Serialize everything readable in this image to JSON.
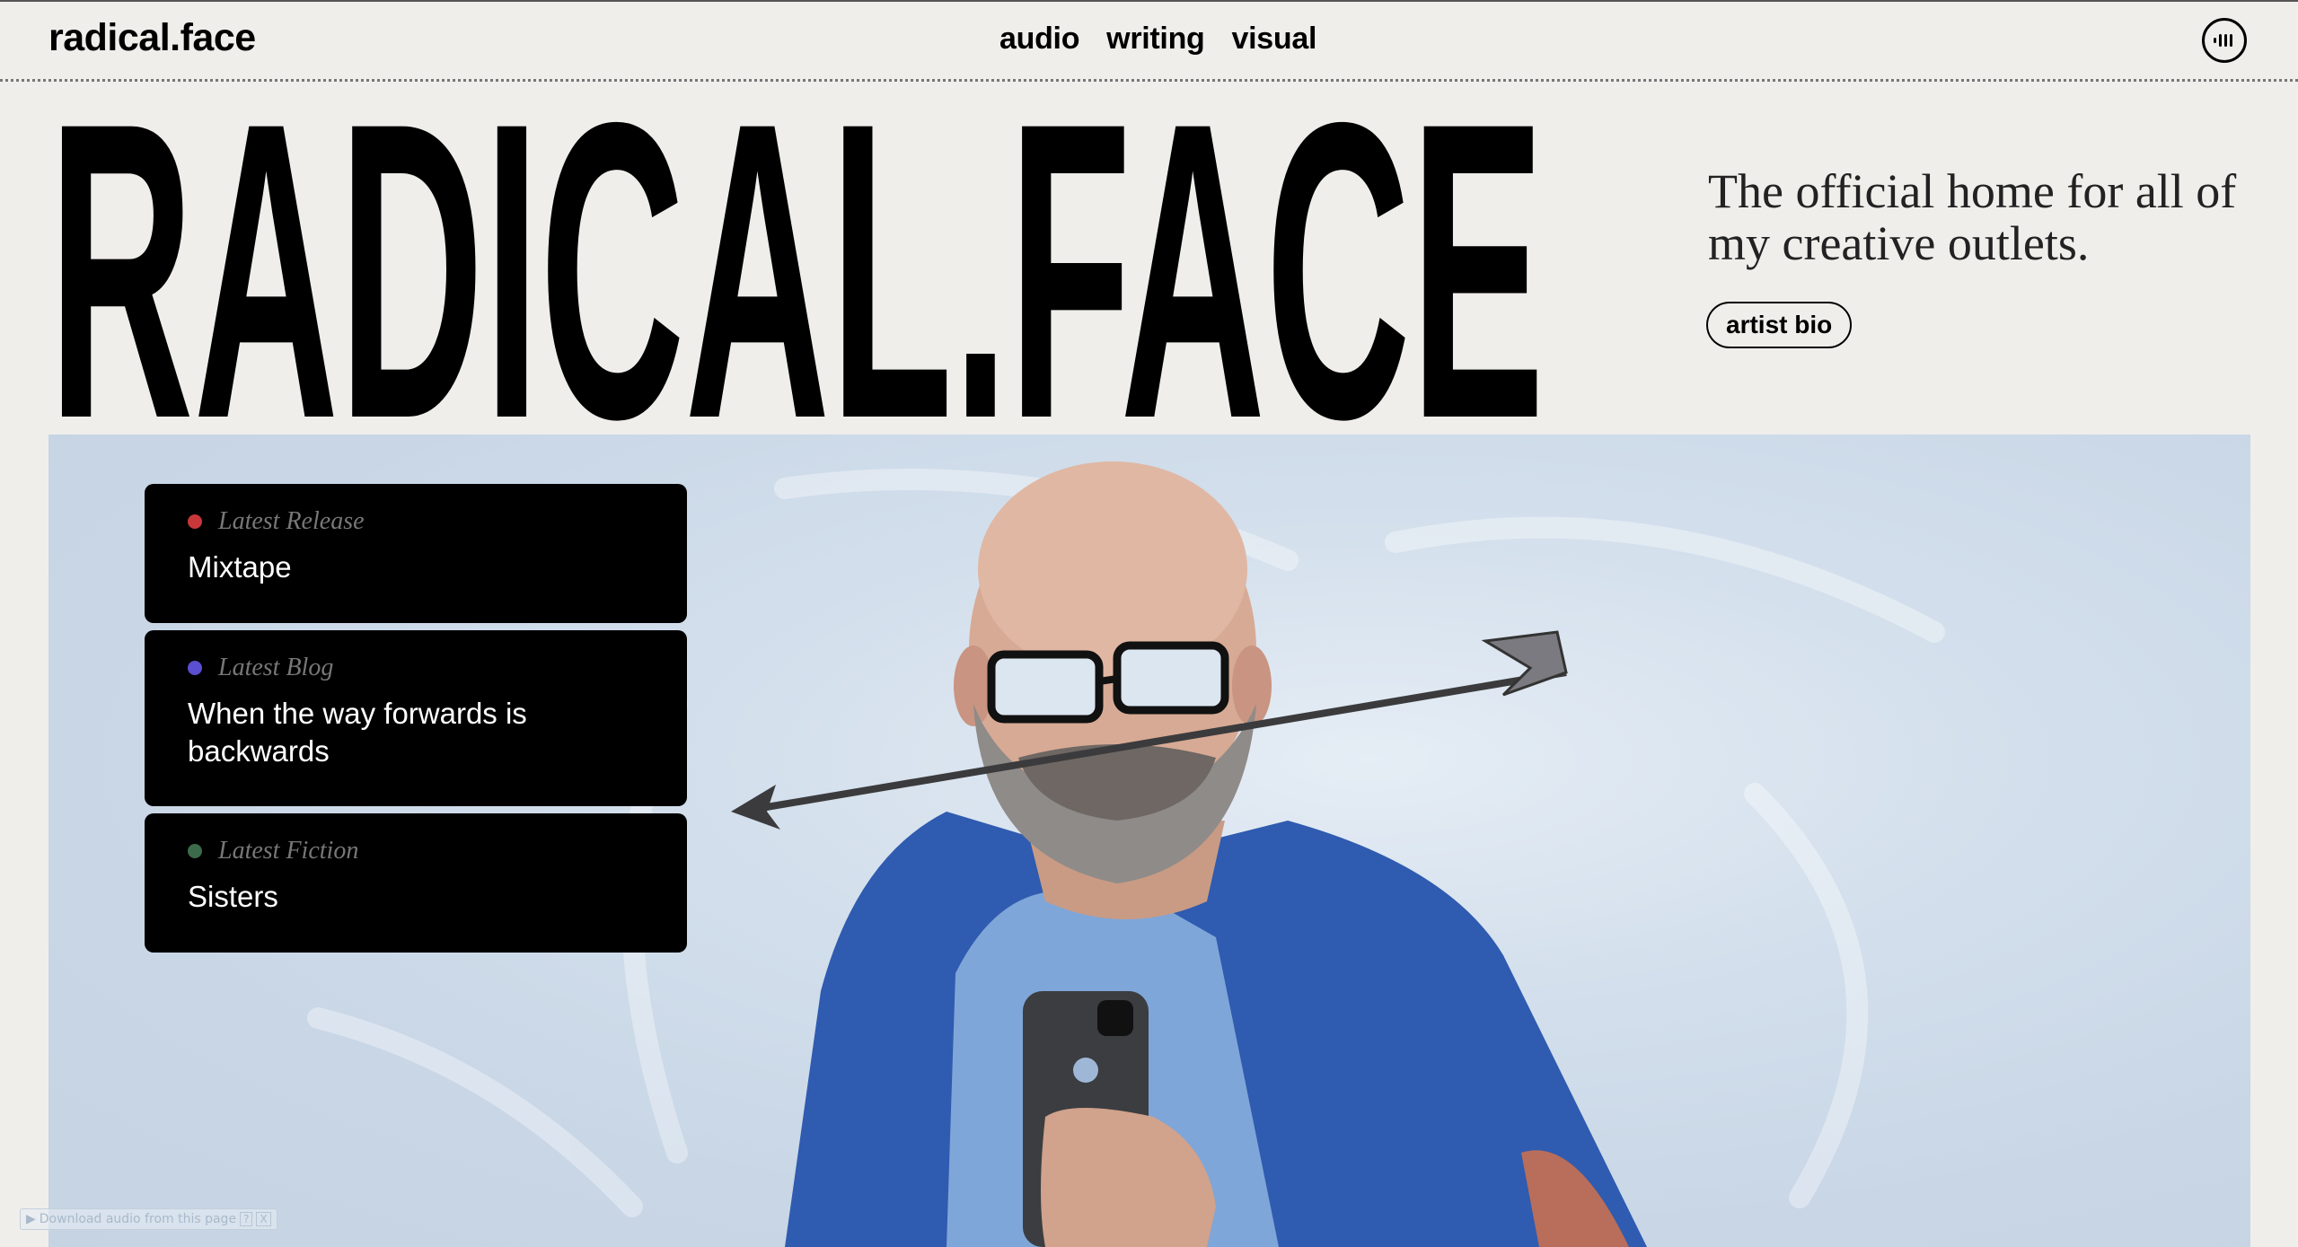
{
  "header": {
    "logo": "radical.face",
    "nav": [
      {
        "label": "audio"
      },
      {
        "label": "writing"
      },
      {
        "label": "visual"
      }
    ],
    "menu_icon": "equalizer-bars-icon"
  },
  "hero": {
    "title": "RADICAL.FACE",
    "tagline": "The official home for all of my creative outlets.",
    "bio_button": "artist bio",
    "image_alt": "Illustrated portrait of a bearded man with glasses, an arrow through his head, holding a phone"
  },
  "cards": [
    {
      "label": "Latest Release",
      "title": "Mixtape",
      "dot_color": "#c8373a"
    },
    {
      "label": "Latest Blog",
      "title": "When the way forwards is backwards",
      "dot_color": "#5a4fd0"
    },
    {
      "label": "Latest Fiction",
      "title": "Sisters",
      "dot_color": "#3c6b4b"
    }
  ],
  "extension_bar": {
    "text": "Download audio from this page",
    "help": "?",
    "close": "X"
  },
  "colors": {
    "background": "#efeeeb",
    "card_bg": "#000000",
    "hero_bg": "#cfdbe8",
    "shirt_blue": "#2f5bb0"
  }
}
